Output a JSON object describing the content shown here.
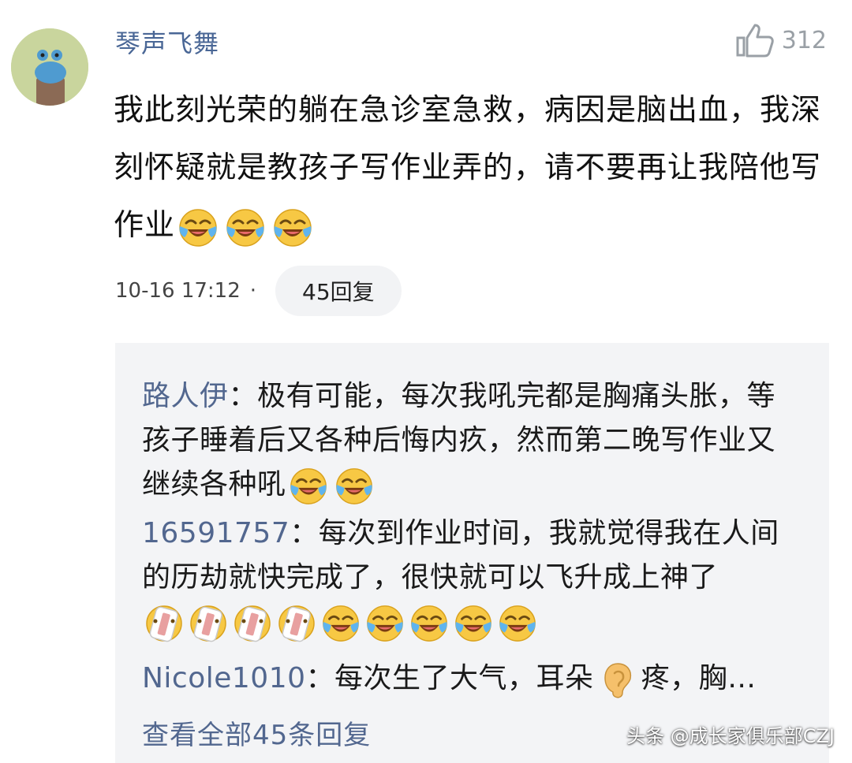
{
  "comment": {
    "username": "琴声飞舞",
    "like_count": "312",
    "text": "我此刻光荣的躺在急诊室急救，病因是脑出血，我深刻怀疑就是教孩子写作业弄的，请不要再让我陪他写作业",
    "emojis": [
      "laugh-cry-emoji",
      "laugh-cry-emoji",
      "laugh-cry-emoji"
    ],
    "timestamp": "10-16 17:12",
    "separator": "·",
    "reply_button": "45回复"
  },
  "replies": [
    {
      "name": "路人伊",
      "colon": "：",
      "text": "极有可能，每次我吼完都是胸痛头胀，等孩子睡着后又各种后悔内疚，然而第二晚写作业又继续各种吼",
      "emojis": [
        "laugh-cry-emoji",
        "laugh-cry-emoji"
      ]
    },
    {
      "name": "16591757",
      "colon": "：",
      "text": "每次到作业时间，我就觉得我在人间的历劫就快完成了，很快就可以飞升成上神了",
      "emojis": [
        "bandage-emoji",
        "bandage-emoji",
        "bandage-emoji",
        "bandage-emoji",
        "laugh-cry-emoji",
        "laugh-cry-emoji",
        "laugh-cry-emoji",
        "laugh-cry-emoji",
        "laugh-cry-emoji"
      ]
    },
    {
      "name": "Nicole1010",
      "colon": "：",
      "text_before": "每次生了大气，耳朵",
      "emoji": "ear-emoji",
      "text_after": "疼，胸…"
    }
  ],
  "view_all": "查看全部45条回复",
  "watermark": "头条 @成长家俱乐部CZJ"
}
